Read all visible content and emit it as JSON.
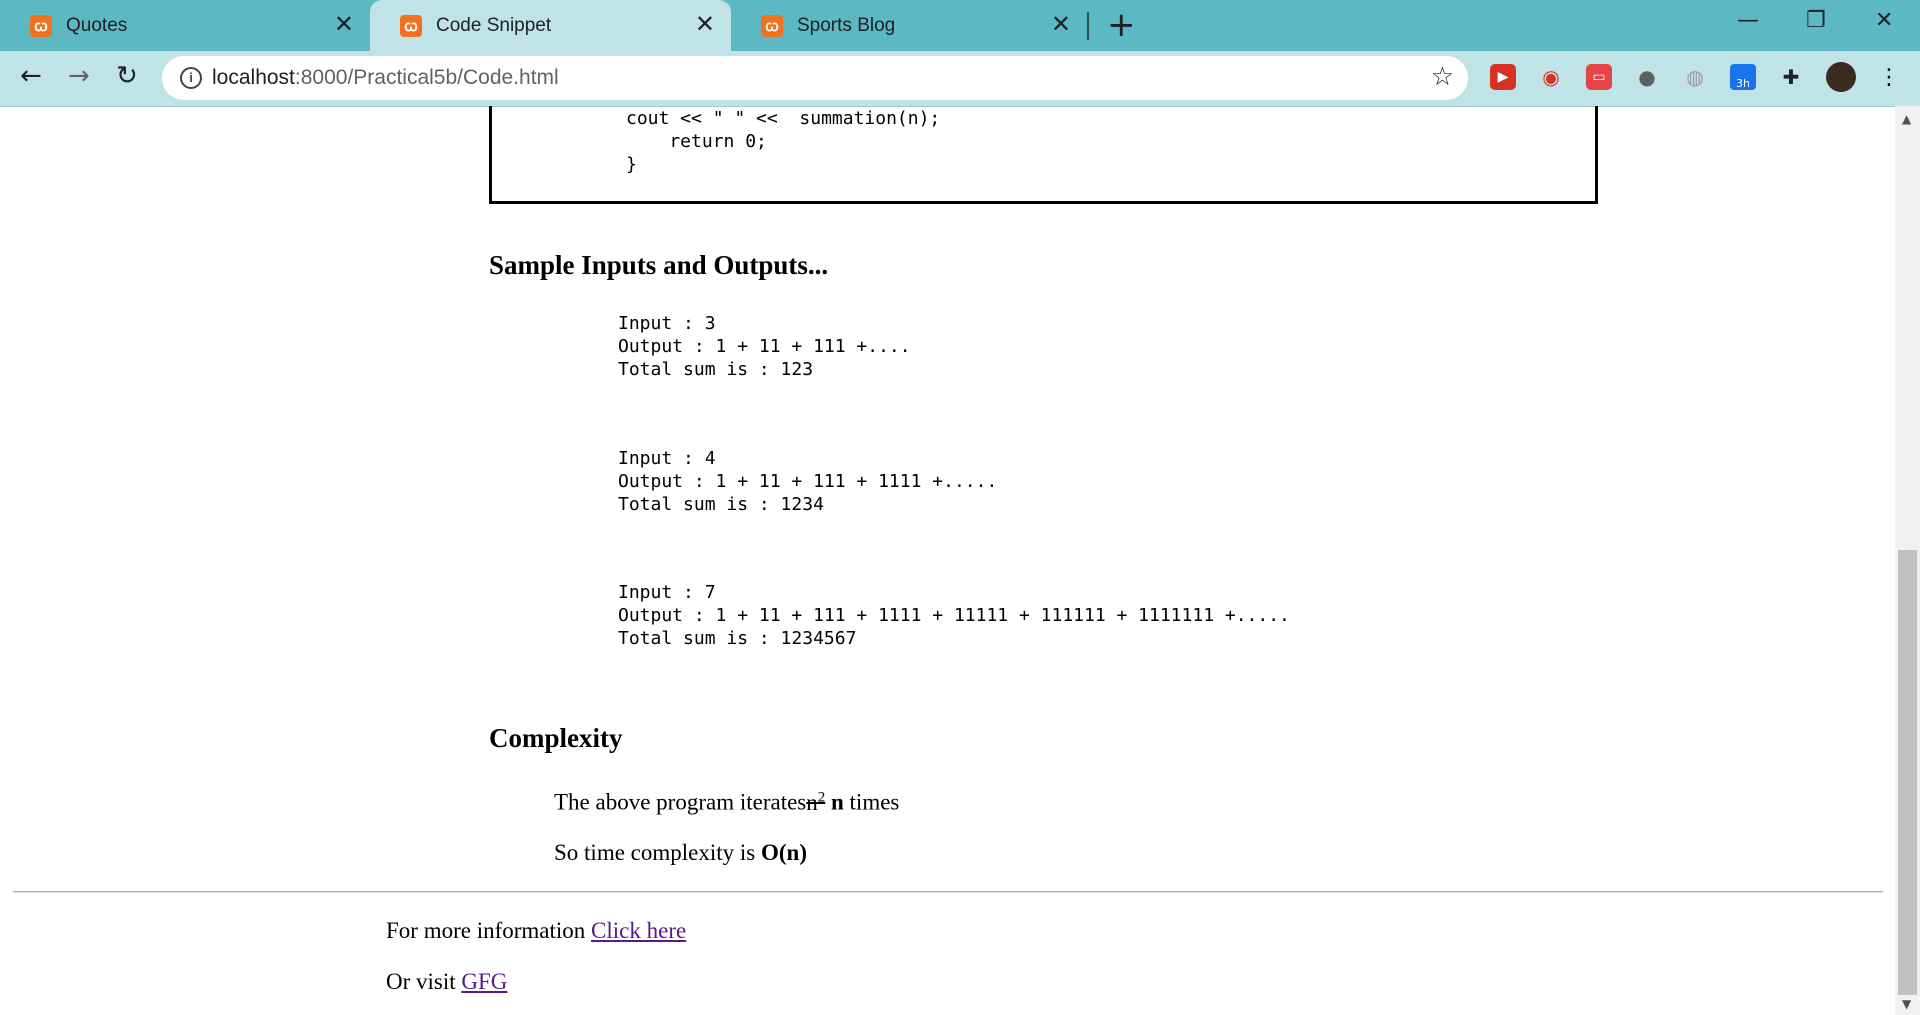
{
  "browser": {
    "tabs": [
      {
        "title": "Quotes",
        "active": false
      },
      {
        "title": "Code Snippet",
        "active": true
      },
      {
        "title": "Sports Blog",
        "active": false
      }
    ],
    "url_host": "localhost",
    "url_path": ":8000/Practical5b/Code.html",
    "favicon_glyph": "ꞷ",
    "accent_color": "#5cb8c2",
    "toolbar_color": "#bfe3e7",
    "extensions": [
      "media-icon",
      "wifi-icon",
      "chat-icon",
      "circle-icon",
      "globe-icon",
      "calendar-icon",
      "puzzle-icon",
      "avatar"
    ],
    "calendar_badge": "3h"
  },
  "code": {
    "lines": "cout << \" \" <<  summation(n);\n    return 0;\n}"
  },
  "samples": {
    "heading": "Sample Inputs and Outputs...",
    "blocks": [
      "Input : 3\nOutput : 1 + 11 + 111 +....\nTotal sum is : 123",
      "Input : 4\nOutput : 1 + 11 + 111 + 1111 +.....\nTotal sum is : 1234",
      "Input : 7\nOutput : 1 + 11 + 111 + 1111 + 11111 + 111111 + 1111111 +.....\nTotal sum is : 1234567"
    ]
  },
  "complexity": {
    "heading": "Complexity",
    "line1_prefix": "The above program iterates",
    "line1_struck": "n",
    "line1_struck_sup": "2",
    "line1_bold": "n",
    "line1_suffix": "times",
    "line2_prefix": "So time complexity is ",
    "line2_bold": "O(n)"
  },
  "footer": {
    "more_info_text": "For more information ",
    "more_info_link": "Click here",
    "visit_text": "Or visit ",
    "visit_link": "GFG"
  }
}
